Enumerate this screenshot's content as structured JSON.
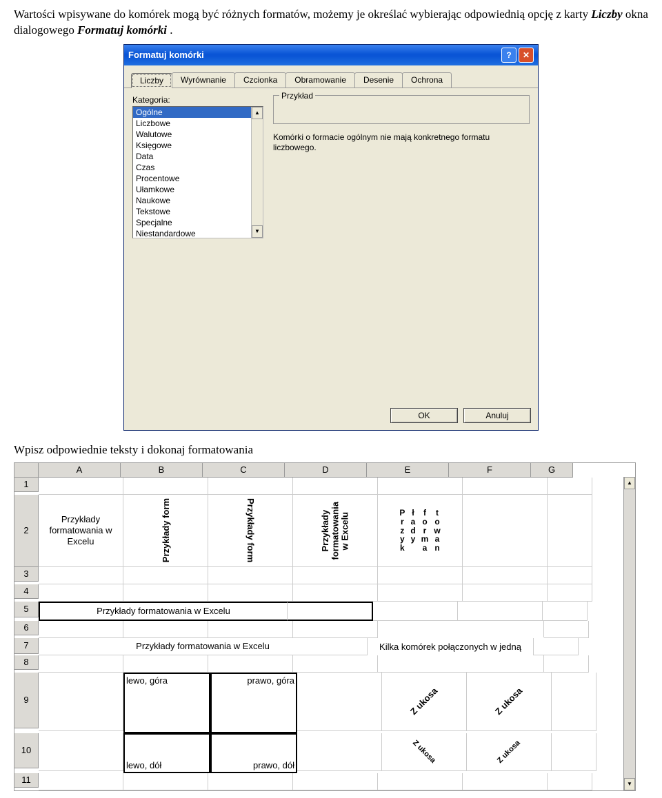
{
  "intro": {
    "line": "Wartości wpisywane do komórek mogą być różnych formatów, możemy je określać wybierając odpowiednią opcję z karty ",
    "liczby": "Liczby",
    "mid": " okna dialogowego ",
    "formatuj": "Formatuj komórki",
    "end": "."
  },
  "dialog": {
    "title": "Formatuj komórki",
    "tabs": [
      "Liczby",
      "Wyrównanie",
      "Czcionka",
      "Obramowanie",
      "Desenie",
      "Ochrona"
    ],
    "category_label": "Kategoria:",
    "categories": [
      "Ogólne",
      "Liczbowe",
      "Walutowe",
      "Księgowe",
      "Data",
      "Czas",
      "Procentowe",
      "Ułamkowe",
      "Naukowe",
      "Tekstowe",
      "Specjalne",
      "Niestandardowe"
    ],
    "sample_label": "Przykład",
    "description": "Komórki o formacie ogólnym nie mają konkretnego formatu liczbowego.",
    "ok": "OK",
    "cancel": "Anuluj"
  },
  "caption2": "Wpisz odpowiednie teksty i dokonaj formatowania",
  "sheet": {
    "cols": [
      "A",
      "B",
      "C",
      "D",
      "E",
      "F",
      "G"
    ],
    "rows": [
      "1",
      "2",
      "3",
      "4",
      "5",
      "6",
      "7",
      "8",
      "9",
      "10",
      "11"
    ],
    "a2": "Przykłady formatowania w Excelu",
    "b2": "Przykłady form",
    "c2": "Przykłady form",
    "d2_top": "Przykłady",
    "d2_mid": "formatowania",
    "d2_bot": "w Excelu",
    "e2_cols": [
      [
        "P",
        "r",
        "z",
        "y",
        "k"
      ],
      [
        "ł",
        "a",
        "d",
        "y"
      ],
      [
        "f",
        "o",
        "r",
        "m",
        "a"
      ],
      [
        "t",
        "o",
        "w",
        "a",
        "n"
      ]
    ],
    "row5": "Przykłady formatowania w Excelu",
    "merged_text": "Kilka komórek połączonych w jedną",
    "row7": "Przykłady formatowania w Excelu",
    "b9": "lewo, góra",
    "c9": "prawo, góra",
    "b10": "lewo, dół",
    "c10": "prawo, dół",
    "ukosa": "Z ukosa",
    "ukosa2": "Z ukosa",
    "ukosa3": "Z ukosa",
    "ukosa4": "Z ukosa"
  }
}
